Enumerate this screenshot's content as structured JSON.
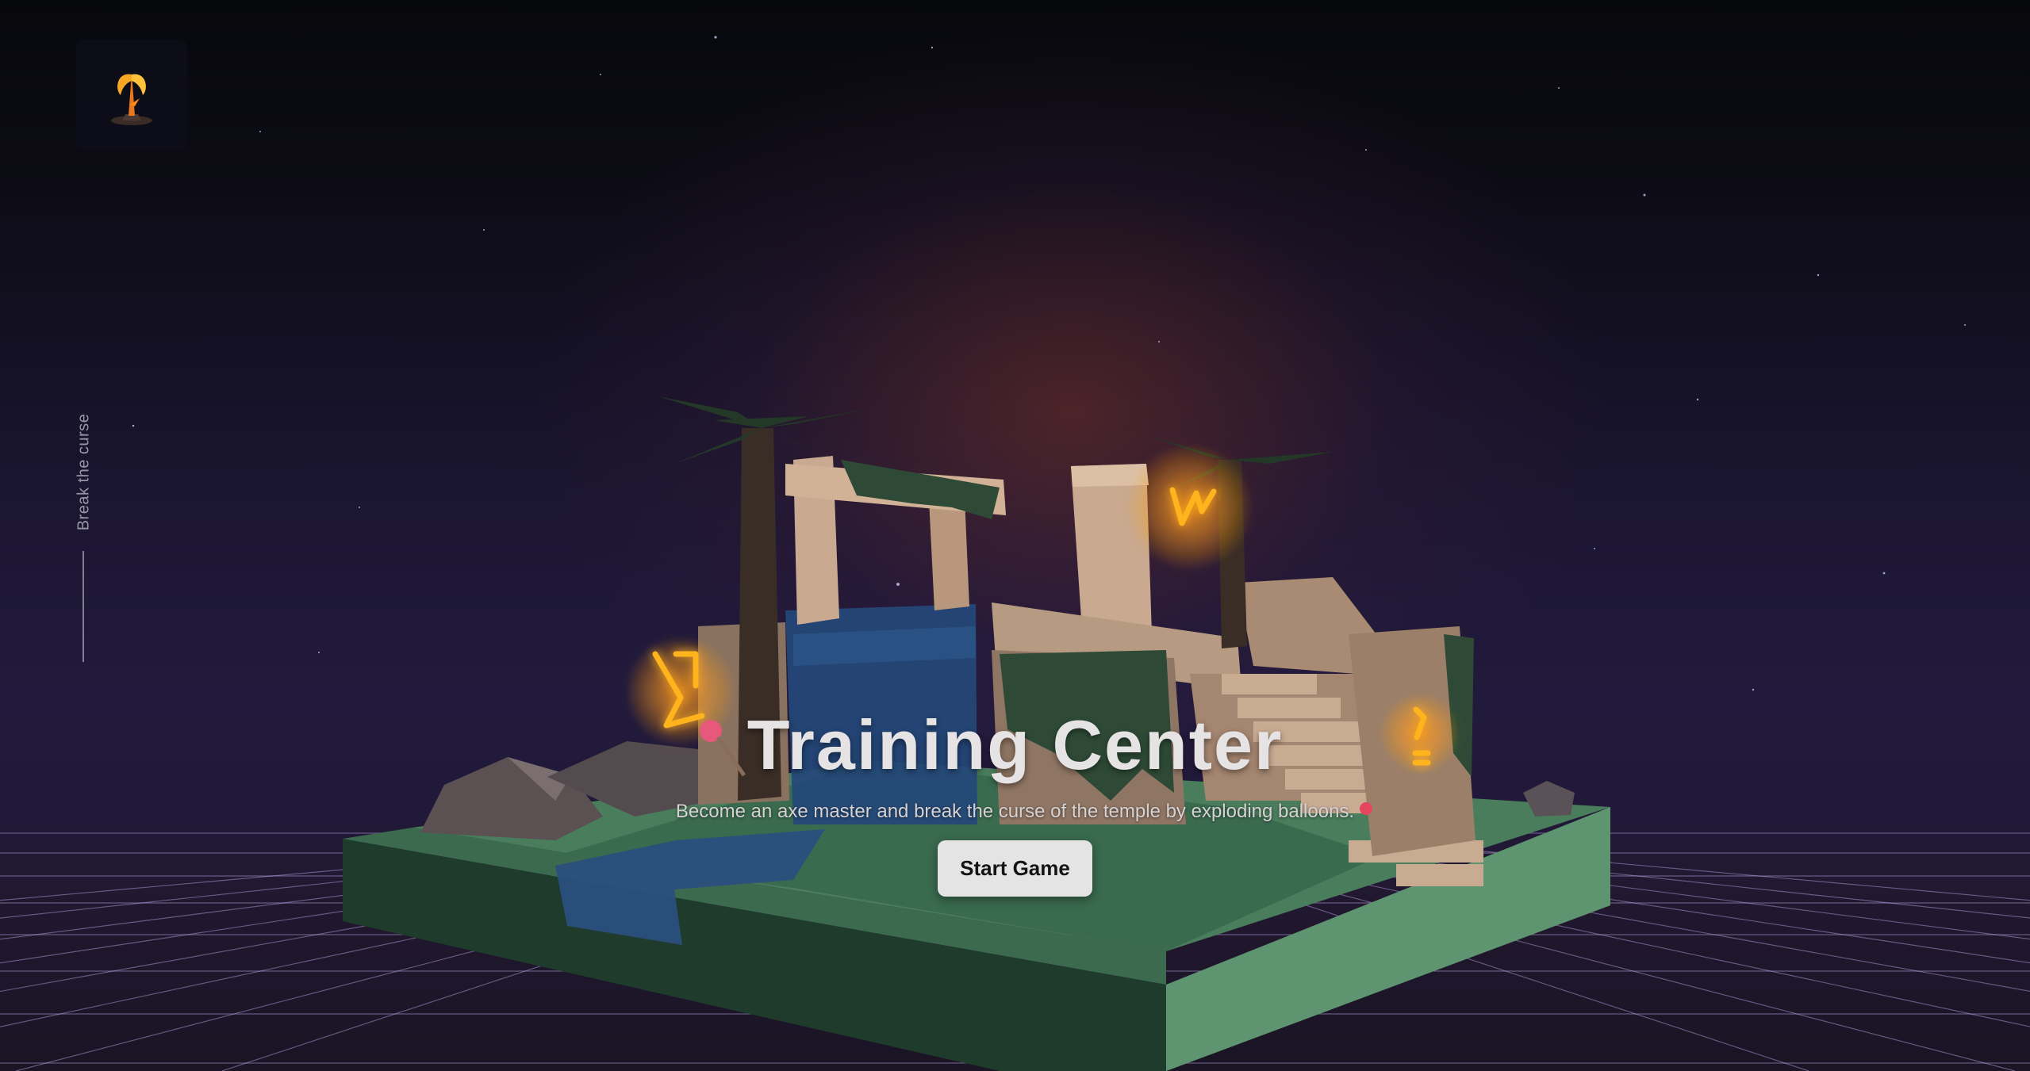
{
  "app": {
    "logo_icon": "flaming-axe-icon",
    "side_caption": "Break the curse"
  },
  "hero": {
    "title": "Training Center",
    "subtitle": "Become an axe master and break the curse of the temple by exploding balloons.",
    "start_button_label": "Start Game"
  },
  "colors": {
    "glow": "#ffb01e",
    "button_bg": "#e4e4e4",
    "grass": "#4f8a63",
    "stone": "#c7a68a"
  }
}
